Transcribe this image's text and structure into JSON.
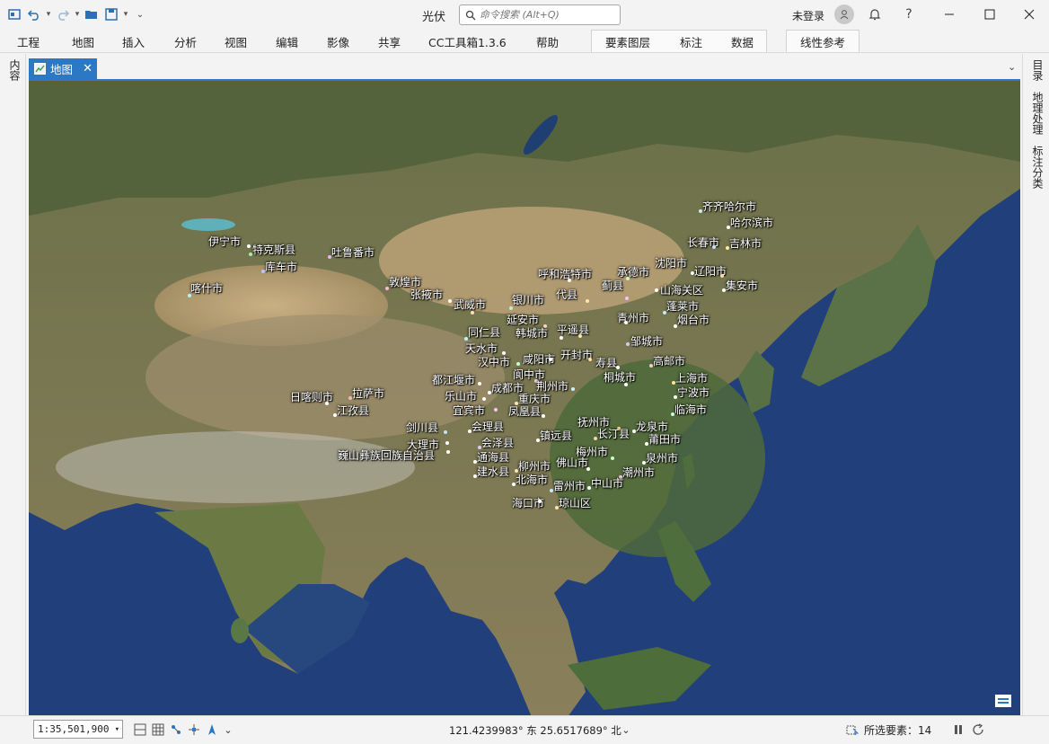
{
  "titlebar": {
    "title": "光伏",
    "search_placeholder": "命令搜索 (Alt+Q)",
    "signin_label": "未登录",
    "help_label": "?"
  },
  "ribbon": {
    "tabs": [
      "工程",
      "地图",
      "插入",
      "分析",
      "视图",
      "编辑",
      "影像",
      "共享",
      "CC工具箱1.3.6",
      "帮助"
    ],
    "context_tabs": [
      "要素图层",
      "标注",
      "数据"
    ],
    "context_tab2": "线性参考"
  },
  "left_dock": {
    "label": "内容"
  },
  "right_dock": {
    "labels": [
      "目录",
      "地理处理",
      "标注分类"
    ]
  },
  "doc_tab": {
    "label": "地图",
    "close": "✕"
  },
  "colors": {
    "accent": "#2b78c5",
    "ocean": "#23417a"
  },
  "map": {
    "cities": [
      {
        "name": "齐齐哈尔市",
        "color": "#cfe8ff"
      },
      {
        "name": "哈尔滨市",
        "color": "#ffffff"
      },
      {
        "name": "长春市",
        "color": "#bde3ff"
      },
      {
        "name": "吉林市",
        "color": "#ffe9a8"
      },
      {
        "name": "伊宁市",
        "color": "#ffffff"
      },
      {
        "name": "特克斯县",
        "color": "#9ef0b0"
      },
      {
        "name": "吐鲁番市",
        "color": "#e6b3ff"
      },
      {
        "name": "库车市",
        "color": "#b9c7ff"
      },
      {
        "name": "喀什市",
        "color": "#b5f0ff"
      },
      {
        "name": "敦煌市",
        "color": "#ffb3d9"
      },
      {
        "name": "张掖市",
        "color": "#ffffff"
      },
      {
        "name": "武威市",
        "color": "#ffe0b3"
      },
      {
        "name": "呼和浩特市",
        "color": "#ffffff"
      },
      {
        "name": "承德市",
        "color": "#c9f7c9"
      },
      {
        "name": "沈阳市",
        "color": "#ffffff"
      },
      {
        "name": "辽阳市",
        "color": "#ffd9b3"
      },
      {
        "name": "集安市",
        "color": "#ffffff"
      },
      {
        "name": "银川市",
        "color": "#c2f0c2"
      },
      {
        "name": "代县",
        "color": "#ffe7a3"
      },
      {
        "name": "蓟县",
        "color": "#f7c1ff"
      },
      {
        "name": "山海关区",
        "color": "#ffffff"
      },
      {
        "name": "蓬莱市",
        "color": "#c7e9ff"
      },
      {
        "name": "烟台市",
        "color": "#ffffff"
      },
      {
        "name": "延安市",
        "color": "#ffd4d4"
      },
      {
        "name": "同仁县",
        "color": "#bdf5ff"
      },
      {
        "name": "韩城市",
        "color": "#ffffff"
      },
      {
        "name": "平遥县",
        "color": "#ffe4a8"
      },
      {
        "name": "青州市",
        "color": "#ffffff"
      },
      {
        "name": "邹城市",
        "color": "#d4c7ff"
      },
      {
        "name": "天水市",
        "color": "#ffffff"
      },
      {
        "name": "汉中市",
        "color": "#c6ffd0"
      },
      {
        "name": "咸阳市",
        "color": "#ffffff"
      },
      {
        "name": "开封市",
        "color": "#ffe0a6"
      },
      {
        "name": "寿县",
        "color": "#ffffff"
      },
      {
        "name": "高邮市",
        "color": "#ffc9c9"
      },
      {
        "name": "都江堰市",
        "color": "#ffffff"
      },
      {
        "name": "阆中市",
        "color": "#ffd4f0"
      },
      {
        "name": "成都市",
        "color": "#ffffff"
      },
      {
        "name": "荆州市",
        "color": "#c9f0ff"
      },
      {
        "name": "桐城市",
        "color": "#ffffff"
      },
      {
        "name": "上海市",
        "color": "#ffe69c"
      },
      {
        "name": "宁波市",
        "color": "#ffffff"
      },
      {
        "name": "乐山市",
        "color": "#ffffff"
      },
      {
        "name": "重庆市",
        "color": "#ffe7b8"
      },
      {
        "name": "日喀则市",
        "color": "#ffffff"
      },
      {
        "name": "拉萨市",
        "color": "#ffb3b3"
      },
      {
        "name": "江孜县",
        "color": "#ffffff"
      },
      {
        "name": "宜宾市",
        "color": "#ffc7e6"
      },
      {
        "name": "凤凰县",
        "color": "#ffffff"
      },
      {
        "name": "临海市",
        "color": "#c7ffd8"
      },
      {
        "name": "会理县",
        "color": "#ffffff"
      },
      {
        "name": "抚州市",
        "color": "#ffe2a6"
      },
      {
        "name": "龙泉市",
        "color": "#ffffff"
      },
      {
        "name": "剑川县",
        "color": "#bfe4ff"
      },
      {
        "name": "镇远县",
        "color": "#ffffff"
      },
      {
        "name": "长汀县",
        "color": "#ffd1a8"
      },
      {
        "name": "莆田市",
        "color": "#ffffff"
      },
      {
        "name": "大理市",
        "color": "#ffffff"
      },
      {
        "name": "会泽县",
        "color": "#e0c8ff"
      },
      {
        "name": "巍山彝族回族自治县",
        "color": "#ffffff"
      },
      {
        "name": "通海县",
        "color": "#ffffff"
      },
      {
        "name": "梅州市",
        "color": "#c8ffd0"
      },
      {
        "name": "泉州市",
        "color": "#ffffff"
      },
      {
        "name": "柳州市",
        "color": "#ffe0b8"
      },
      {
        "name": "佛山市",
        "color": "#ffffff"
      },
      {
        "name": "建水县",
        "color": "#ffffff"
      },
      {
        "name": "潮州市",
        "color": "#ffc9f0"
      },
      {
        "name": "北海市",
        "color": "#ffffff"
      },
      {
        "name": "中山市",
        "color": "#ffffff"
      },
      {
        "name": "雷州市",
        "color": "#c4ecff"
      },
      {
        "name": "海口市",
        "color": "#ffffff"
      },
      {
        "name": "琼山区",
        "color": "#ffe2a8"
      }
    ]
  },
  "statusbar": {
    "scale": "1:35,501,900",
    "coordinates": "121.4239983° 东  25.6517689° 北",
    "selected_label": "所选要素：",
    "selected_count": "14"
  }
}
